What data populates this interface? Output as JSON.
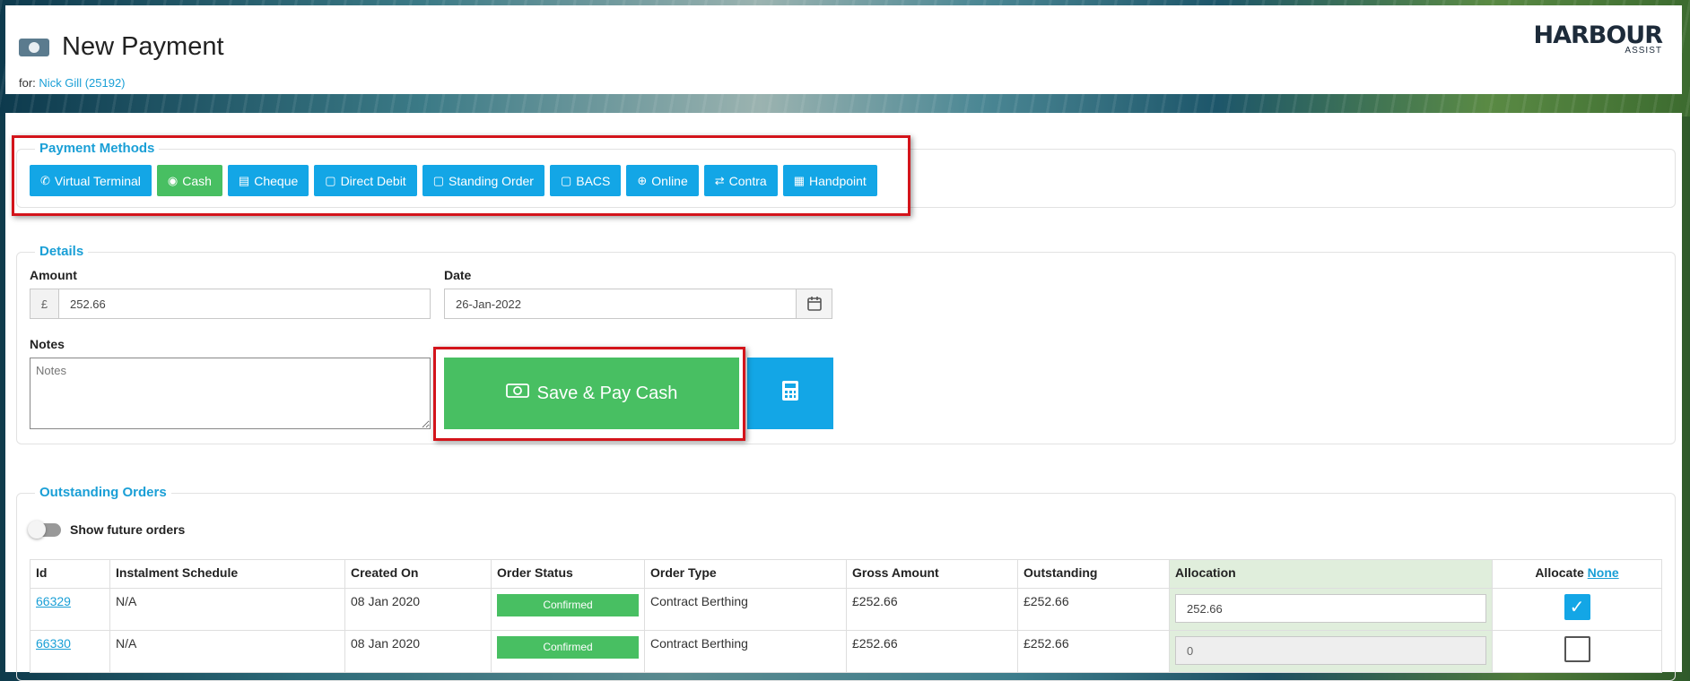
{
  "header": {
    "title": "New Payment",
    "for_label": "for:",
    "customer": "Nick Gill (25192)",
    "logo_text": "HARBOUR",
    "logo_sub": "ASSIST"
  },
  "payment_methods": {
    "legend": "Payment Methods",
    "buttons": [
      {
        "label": "Virtual Terminal",
        "icon": "phone-icon",
        "glyph": "✆"
      },
      {
        "label": "Cash",
        "icon": "money-icon",
        "glyph": "◉"
      },
      {
        "label": "Cheque",
        "icon": "cheque-icon",
        "glyph": "▤"
      },
      {
        "label": "Direct Debit",
        "icon": "calendar-icon",
        "glyph": "▢"
      },
      {
        "label": "Standing Order",
        "icon": "calendar-icon",
        "glyph": "▢"
      },
      {
        "label": "BACS",
        "icon": "calendar-icon",
        "glyph": "▢"
      },
      {
        "label": "Online",
        "icon": "globe-icon",
        "glyph": "⊕"
      },
      {
        "label": "Contra",
        "icon": "exchange-icon",
        "glyph": "⇄"
      },
      {
        "label": "Handpoint",
        "icon": "calculator-icon",
        "glyph": "▦"
      }
    ],
    "active": "Cash"
  },
  "details": {
    "legend": "Details",
    "amount_label": "Amount",
    "currency": "£",
    "amount": "252.66",
    "date_label": "Date",
    "date": "26-Jan-2022",
    "notes_label": "Notes",
    "notes_placeholder": "Notes",
    "save_label": "Save & Pay Cash"
  },
  "orders": {
    "legend": "Outstanding Orders",
    "toggle_label": "Show future orders",
    "columns": [
      "Id",
      "Instalment Schedule",
      "Created On",
      "Order Status",
      "Order Type",
      "Gross Amount",
      "Outstanding",
      "Allocation",
      "Allocate"
    ],
    "allocate_none": "None",
    "rows": [
      {
        "id": "66329",
        "schedule": "N/A",
        "created": "08 Jan 2020",
        "status": "Confirmed",
        "type": "Contract Berthing",
        "gross": "£252.66",
        "outstanding": "£252.66",
        "allocation": "252.66",
        "checked": true
      },
      {
        "id": "66330",
        "schedule": "N/A",
        "created": "08 Jan 2020",
        "status": "Confirmed",
        "type": "Contract Berthing",
        "gross": "£252.66",
        "outstanding": "£252.66",
        "allocation": "0",
        "checked": false
      }
    ]
  },
  "colors": {
    "primary": "#13a6e6",
    "success": "#48bf62",
    "highlight": "#d3141b"
  }
}
